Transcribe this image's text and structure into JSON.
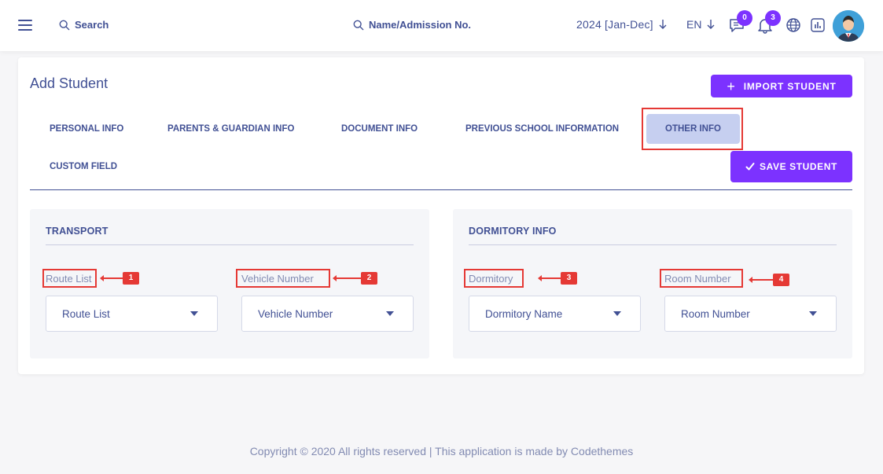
{
  "topbar": {
    "search_label": "Search",
    "name_search_label": "Name/Admission No.",
    "year": "2024 [Jan-Dec]",
    "language": "EN",
    "messages_badge": "0",
    "notifications_badge": "3",
    "accent": "#7c32ff"
  },
  "page": {
    "title": "Add Student",
    "import_button": "IMPORT STUDENT",
    "save_button": "SAVE STUDENT"
  },
  "tabs": [
    {
      "label": "PERSONAL INFO"
    },
    {
      "label": "PARENTS & GUARDIAN INFO"
    },
    {
      "label": "DOCUMENT INFO"
    },
    {
      "label": "PREVIOUS SCHOOL INFORMATION"
    },
    {
      "label": "OTHER INFO",
      "active": true
    },
    {
      "label": "CUSTOM FIELD"
    }
  ],
  "transport": {
    "title": "TRANSPORT",
    "route_label": "Route List",
    "route_placeholder": "Route List",
    "vehicle_label": "Vehicle Number",
    "vehicle_placeholder": "Vehicle Number"
  },
  "dormitory": {
    "title": "DORMITORY INFO",
    "dormitory_label": "Dormitory",
    "dormitory_placeholder": "Dormitory Name",
    "room_label": "Room Number",
    "room_placeholder": "Room Number"
  },
  "callouts": [
    "1",
    "2",
    "3",
    "4"
  ],
  "footer": "Copyright © 2020 All rights reserved | This application is made by Codethemes"
}
